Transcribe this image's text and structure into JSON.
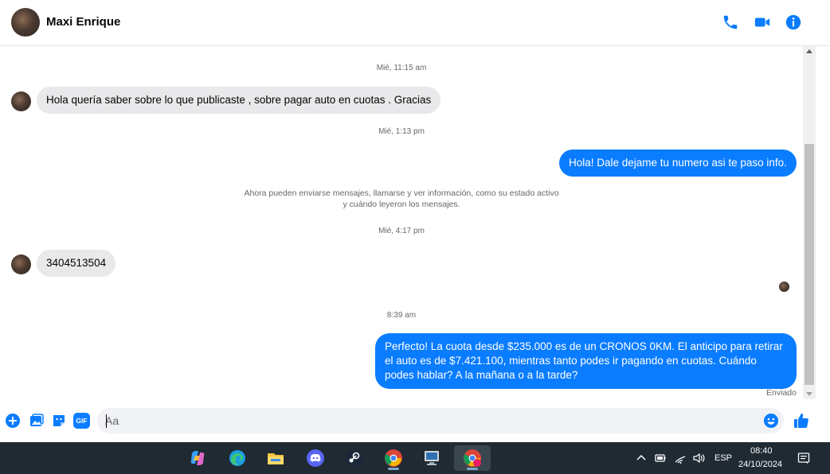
{
  "header": {
    "contact_name": "Maxi Enrique",
    "icons": [
      "phone-icon",
      "video-icon",
      "info-icon"
    ],
    "accent_color": "#0a7cff"
  },
  "messages": {
    "ts1": "Mié, 11:15 am",
    "m1": "Hola quería saber sobre lo que publicaste , sobre pagar auto en cuotas . Gracias",
    "ts2": "Mié, 1:13 pm",
    "m2": "Hola! Dale dejame tu numero  asi te paso info.",
    "system_line1": "Ahora pueden enviarse mensajes, llamarse y ver información, como su estado activo",
    "system_line2": "y cuándo leyeron los mensajes.",
    "ts3": "Mié, 4:17 pm",
    "m3": "3404513504",
    "ts4": "8:39 am",
    "m4": "Perfecto! La cuota desde $235.000 es de un CRONOS 0KM. El anticipo para retirar el auto es de $7.421.100, mientras tanto podes ir pagando en cuotas. Cuándo podes hablar? A la mañana o a la tarde?",
    "status": "Enviado"
  },
  "composer": {
    "placeholder": "Aa",
    "gif_label": "GIF",
    "icons": [
      "plus-icon",
      "image-icon",
      "sticker-icon",
      "gif-icon",
      "emoji-icon",
      "like-icon"
    ]
  },
  "taskbar": {
    "apps": [
      "copilot-icon",
      "edge-icon",
      "file-explorer-icon",
      "discord-icon",
      "steam-icon",
      "chrome-icon",
      "network-monitor-icon",
      "chrome-profile-icon"
    ],
    "language": "ESP",
    "time": "08:40",
    "date": "24/10/2024"
  },
  "colors": {
    "incoming_bubble": "#e9e9eb",
    "outgoing_bubble": "#0a7cff",
    "taskbar": "#1f2a33"
  }
}
